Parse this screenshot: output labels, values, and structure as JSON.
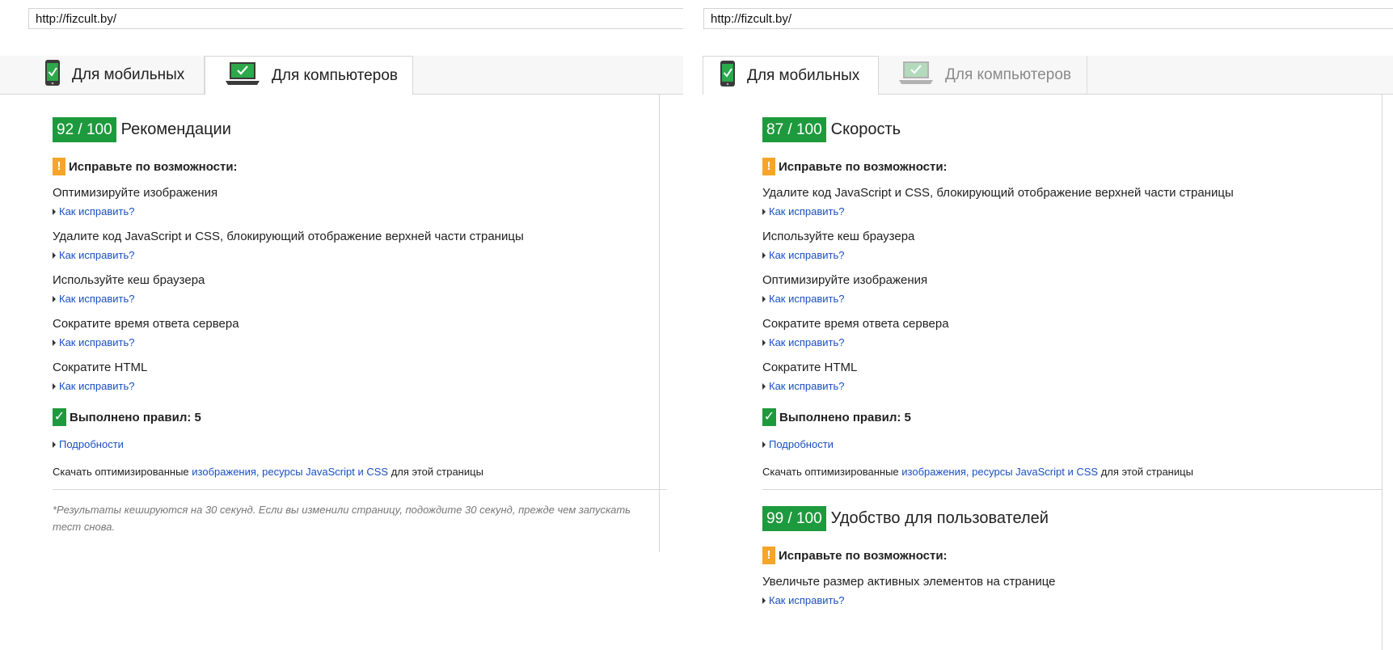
{
  "left": {
    "url": "http://fizcult.by/",
    "tabs": [
      {
        "label": "Для мобильных",
        "active": false,
        "icon": "phone-check-icon"
      },
      {
        "label": "Для компьютеров",
        "active": true,
        "icon": "laptop-check-icon"
      }
    ],
    "score": "92 / 100",
    "score_title": "Рекомендации",
    "fix_heading": "Исправьте по возможности:",
    "rules": [
      {
        "title": "Оптимизируйте изображения",
        "link": "Как исправить?"
      },
      {
        "title": "Удалите код JavaScript и CSS, блокирующий отображение верхней части страницы",
        "link": "Как исправить?"
      },
      {
        "title": "Используйте кеш браузера",
        "link": "Как исправить?"
      },
      {
        "title": "Сократите время ответа сервера",
        "link": "Как исправить?"
      },
      {
        "title": "Сократите HTML",
        "link": "Как исправить?"
      }
    ],
    "passed": "Выполнено правил: 5",
    "details": "Подробности",
    "download": {
      "prefix": "Скачать оптимизированные",
      "link_images": "изображения",
      "sep": ",",
      "link_resources": "ресурсы JavaScript и CSS",
      "suffix": "для этой страницы"
    },
    "footnote": "*Результаты кешируются на 30 секунд. Если вы изменили страницу, подождите 30 секунд, прежде чем запускать тест снова."
  },
  "right": {
    "url": "http://fizcult.by/",
    "tabs": [
      {
        "label": "Для мобильных",
        "active": true,
        "icon": "phone-check-icon"
      },
      {
        "label": "Для компьютеров",
        "active": false,
        "icon": "laptop-check-icon"
      }
    ],
    "score": "87 / 100",
    "score_title": "Скорость",
    "fix_heading": "Исправьте по возможности:",
    "rules": [
      {
        "title": "Удалите код JavaScript и CSS, блокирующий отображение верхней части страницы",
        "link": "Как исправить?"
      },
      {
        "title": "Используйте кеш браузера",
        "link": "Как исправить?"
      },
      {
        "title": "Оптимизируйте изображения",
        "link": "Как исправить?"
      },
      {
        "title": "Сократите время ответа сервера",
        "link": "Как исправить?"
      },
      {
        "title": "Сократите HTML",
        "link": "Как исправить?"
      }
    ],
    "passed": "Выполнено правил: 5",
    "details": "Подробности",
    "download": {
      "prefix": "Скачать оптимизированные",
      "link_images": "изображения",
      "sep": ",",
      "link_resources": "ресурсы JavaScript и CSS",
      "suffix": "для этой страницы"
    },
    "usability": {
      "score": "99 / 100",
      "score_title": "Удобство для пользователей",
      "fix_heading": "Исправьте по возможности:",
      "rules": [
        {
          "title": "Увеличьте размер активных элементов на странице",
          "link": "Как исправить?"
        }
      ]
    }
  },
  "colors": {
    "good": "#1e9a3e",
    "warn": "#f4a52a",
    "link": "#1a4fc1"
  }
}
